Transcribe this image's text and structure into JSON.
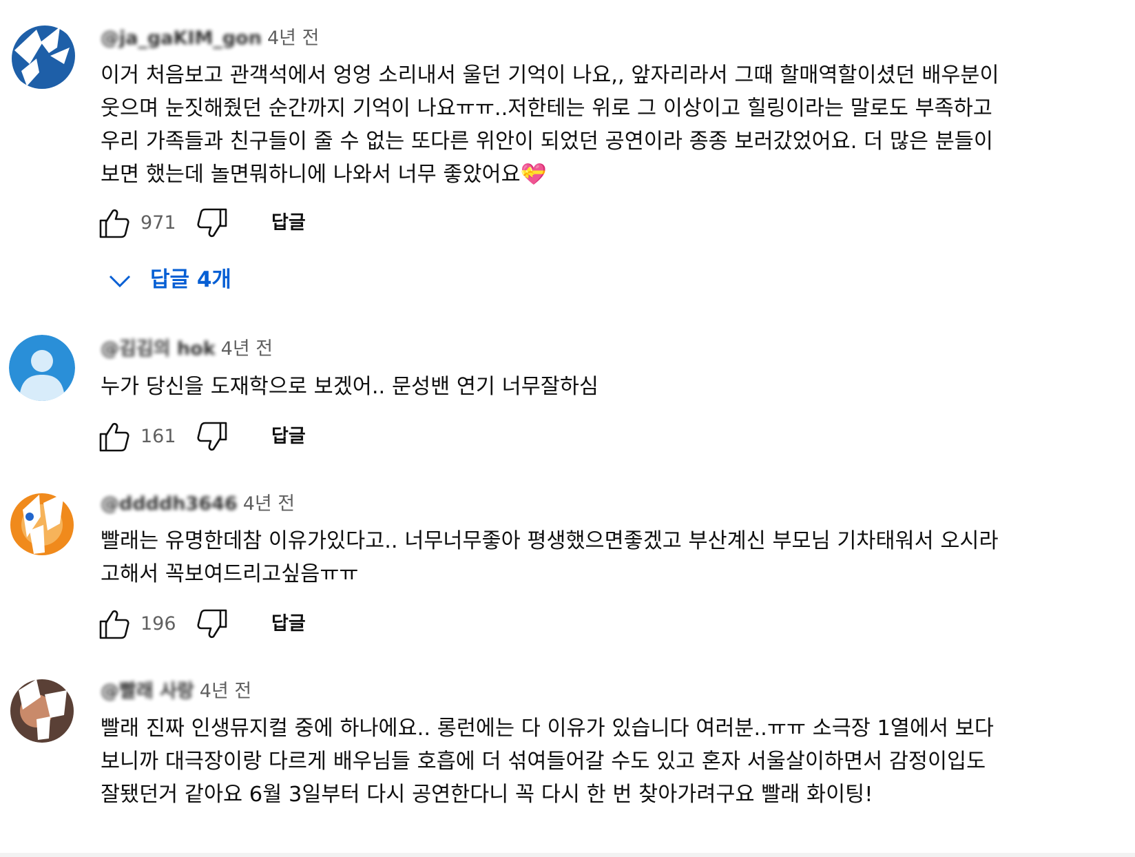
{
  "colors": {
    "link_blue": "#065fd4",
    "meta_gray": "#606060",
    "text": "#0f0f0f"
  },
  "icons": {
    "like": "thumb-up-outline-icon",
    "dislike": "thumb-down-outline-icon",
    "expand": "chevron-down-icon"
  },
  "comments": [
    {
      "author": "@ja_gaKIM_gon",
      "time": "4년 전",
      "text": "이거 처음보고 관객석에서 엉엉 소리내서 울던 기억이 나요,, 앞자리라서 그때 할매역할이셨던 배우분이\n웃으며 눈짓해줬던 순간까지 기억이 나요ㅠㅠ..저한테는 위로 그 이상이고 힐링이라는 말로도 부족하고\n우리 가족들과 친구들이 줄 수 없는 또다른 위안이 되었던 공연이라 종종 보러갔었어요. 더 많은 분들이\n보면 했는데 놀면뭐하니에 나와서 너무 좋았어요💝",
      "likes": "971",
      "reply_label": "답글",
      "replies_label": "답글 4개"
    },
    {
      "author": "@김김의 hok",
      "time": "4년 전",
      "text": "누가 당신을 도재학으로 보겠어.. 문성밴 연기 너무잘하심",
      "likes": "161",
      "reply_label": "답글"
    },
    {
      "author": "@ddddh3646",
      "time": "4년 전",
      "text": "빨래는 유명한데참 이유가있다고.. 너무너무좋아 평생했으면좋겠고 부산계신 부모님 기차태워서 오시라\n고해서 꼭보여드리고싶음ㅠㅠ",
      "likes": "196",
      "reply_label": "답글"
    },
    {
      "author": "@빨래 사랑",
      "time": "4년 전",
      "text": "빨래 진짜 인생뮤지컬 중에 하나에요.. 롱런에는 다 이유가 있습니다 여러분..ㅠㅠ  소극장 1열에서 보다\n보니까 대극장이랑 다르게 배우님들 호흡에 더 섞여들어갈 수도 있고 혼자 서울살이하면서 감정이입도\n잘됐던거 같아요 6월 3일부터 다시 공연한다니 꼭 다시 한 번 찾아가려구요 빨래 화이팅!",
      "likes": "",
      "reply_label": ""
    }
  ]
}
